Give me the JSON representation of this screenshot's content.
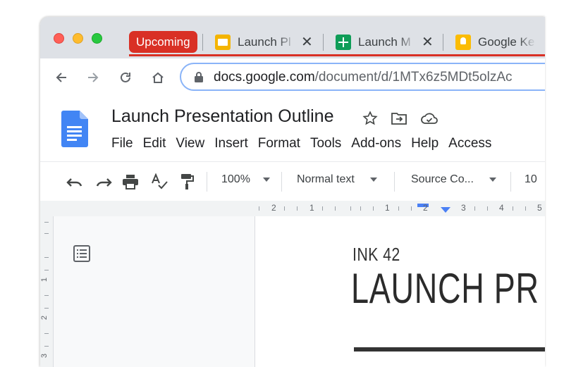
{
  "browser": {
    "tab_group": {
      "label": "Upcoming",
      "color": "#d93025"
    },
    "tabs": [
      {
        "title": "Launch Pl",
        "icon": "slides-icon"
      },
      {
        "title": "Launch M",
        "icon": "sheets-icon"
      },
      {
        "title": "Google Ke",
        "icon": "keep-icon"
      }
    ],
    "close_glyph": "✕",
    "url_host": "docs.google.com",
    "url_path": "/document/d/1MTx6z5MDt5olzAc"
  },
  "doc": {
    "title": "Launch Presentation Outline",
    "menu": [
      "File",
      "Edit",
      "View",
      "Insert",
      "Format",
      "Tools",
      "Add-ons",
      "Help",
      "Access"
    ]
  },
  "toolbar": {
    "zoom": "100%",
    "style": "Normal text",
    "font": "Source Co...",
    "size": "10"
  },
  "ruler": {
    "labels": [
      "2",
      "1",
      "1",
      "2",
      "3",
      "4",
      "5"
    ]
  },
  "vruler": {
    "labels": [
      "1",
      "2",
      "3"
    ]
  },
  "page": {
    "kicker": "INK 42",
    "heading": "LAUNCH PR"
  }
}
